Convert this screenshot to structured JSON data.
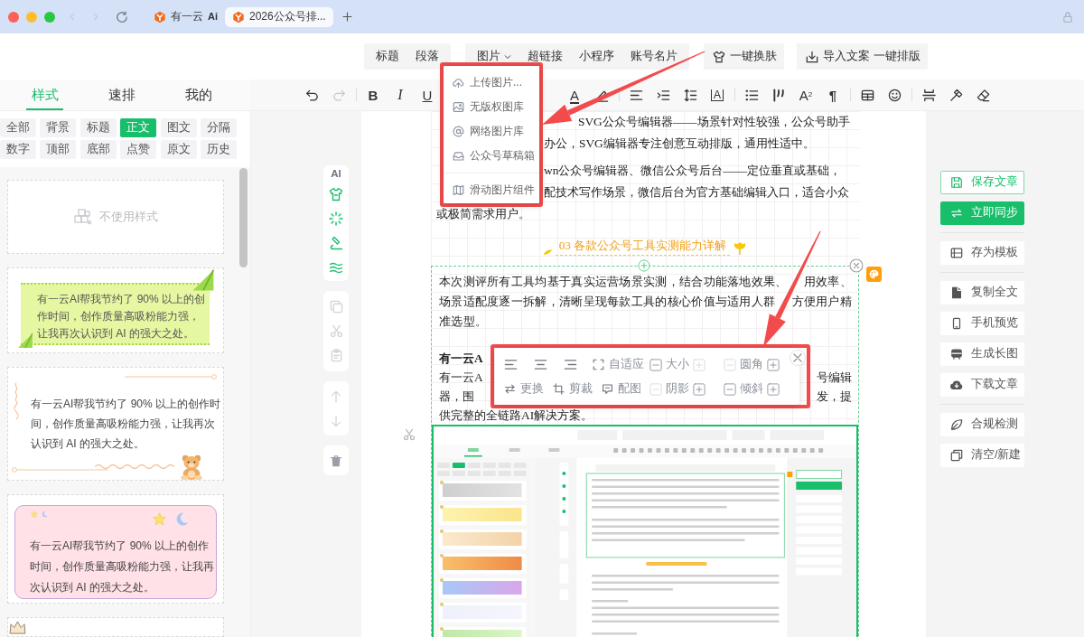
{
  "browser": {
    "tabs": [
      {
        "title": "有一云",
        "badge": "Ai",
        "selected": false
      },
      {
        "title": "2026公众号排...",
        "selected": true
      }
    ]
  },
  "insert_bar": {
    "groups": [
      [
        {
          "kind": "link",
          "label": "标题"
        },
        {
          "kind": "link",
          "label": "段落"
        }
      ],
      [
        {
          "kind": "menu",
          "label": "图片",
          "expanded": true
        },
        {
          "kind": "link",
          "label": "超链接"
        },
        {
          "kind": "link",
          "label": "小程序"
        },
        {
          "kind": "link",
          "label": "账号名片"
        }
      ]
    ],
    "actions": [
      {
        "label": "一键换肤"
      },
      {
        "label": "导入文案 一键排版"
      }
    ]
  },
  "image_menu": {
    "sections": [
      [
        {
          "label": "上传图片..."
        },
        {
          "label": "无版权图库"
        },
        {
          "label": "网络图片库"
        },
        {
          "label": "公众号草稿箱"
        }
      ],
      [
        {
          "label": "滑动图片组件"
        }
      ]
    ]
  },
  "panel_tabs": [
    {
      "label": "样式",
      "selected": true
    },
    {
      "label": "速排",
      "selected": false
    },
    {
      "label": "我的",
      "selected": false
    }
  ],
  "categories": [
    {
      "label": "全部",
      "selected": false
    },
    {
      "label": "背景",
      "selected": false
    },
    {
      "label": "标题",
      "selected": false
    },
    {
      "label": "正文",
      "selected": true
    },
    {
      "label": "图文",
      "selected": false
    },
    {
      "label": "分隔",
      "selected": false
    },
    {
      "label": "数字",
      "selected": false
    },
    {
      "label": "顶部",
      "selected": false
    },
    {
      "label": "底部",
      "selected": false
    },
    {
      "label": "点赞",
      "selected": false
    },
    {
      "label": "原文",
      "selected": false
    },
    {
      "label": "历史",
      "selected": false
    }
  ],
  "style_cards": [
    {
      "kind": "none",
      "label": "不使用样式"
    },
    {
      "kind": "green-note",
      "text": "有一云AI帮我节约了 90% 以上的创作时间，创作质量高吸粉能力强，让我再次认识到 AI 的强大之处。"
    },
    {
      "kind": "bear-note",
      "text": "有一云AI帮我节约了 90% 以上的创作时间，创作质量高吸粉能力强，让我再次认识到 AI 的强大之处。"
    },
    {
      "kind": "night-note",
      "text": "有一云AI帮我节约了 90% 以上的创作时间，创作质量高吸粉能力强，让我再次认识到 AI 的强大之处。"
    },
    {
      "kind": "cut-off"
    }
  ],
  "format_toolbar": {
    "left": [
      {
        "kind": "undo",
        "disabled": false
      },
      {
        "kind": "redo",
        "disabled": true
      },
      {
        "kind": "separator"
      },
      {
        "kind": "bold",
        "glyph": "B",
        "disabled": false
      },
      {
        "kind": "italic",
        "glyph": "I",
        "disabled": false
      },
      {
        "kind": "underline",
        "glyph": "U",
        "disabled": false
      }
    ],
    "right": [
      {
        "kind": "font-color",
        "glyph": "A",
        "disabled": false
      },
      {
        "kind": "highlight",
        "disabled": false
      },
      {
        "kind": "separator"
      },
      {
        "kind": "align",
        "disabled": false
      },
      {
        "kind": "indent",
        "disabled": false
      },
      {
        "kind": "line-height",
        "disabled": false
      },
      {
        "kind": "letter-spacing",
        "glyph": "A",
        "disabled": false
      },
      {
        "kind": "separator"
      },
      {
        "kind": "list",
        "disabled": false
      },
      {
        "kind": "quote",
        "disabled": false
      },
      {
        "kind": "superscript",
        "glyph": "A$^{2}$",
        "disabled": false
      },
      {
        "kind": "paragraph",
        "glyph": "¶",
        "disabled": false
      },
      {
        "kind": "separator"
      },
      {
        "kind": "table",
        "disabled": false
      },
      {
        "kind": "emoji",
        "disabled": false
      },
      {
        "kind": "separator"
      },
      {
        "kind": "rule",
        "disabled": false
      },
      {
        "kind": "painter",
        "disabled": false
      },
      {
        "kind": "eraser",
        "disabled": false
      }
    ]
  },
  "block_tools": {
    "label": "AI",
    "clipboard_disabled": true
  },
  "article": {
    "covered_paragraphs": [
      {
        "lines": [
          "SVG公众号编辑器——场景针对性较强，公众号助手",
          "办公，SVG编辑器专注创意互动排版，通用性适中。"
        ]
      },
      {
        "lines": [
          "wn公众号编辑器、微信公众号后台——定位垂直或基础，",
          "配技术写作场景，微信后台为官方基础编辑入口，适合小众"
        ],
        "last_line": "或极简需求用户。"
      }
    ],
    "section_heading": "03 各款公众号工具实测能力详解",
    "selected_block": {
      "paragraph_lines": [
        {
          "left": "本次测评所有工具均基于真实运营场景实测，结合功能落地效果、",
          "right": "用效率、"
        },
        {
          "left": "场景适配度逐一拆解，清晰呈现每款工具的核心价值与适用人群",
          "right": "方便用户精"
        },
        {
          "left": "准选型。"
        }
      ],
      "covered_lines": [
        {
          "left": "有一云A",
          "bold": true
        },
        {
          "left": "有一云A",
          "right": "号编辑",
          "bold": false
        },
        {
          "left": "器，围",
          "right": "发，提",
          "bold": false
        }
      ],
      "last_line": "供完整的全链路AI解决方案。"
    }
  },
  "image_toolbar": {
    "rows": [
      {
        "tools": [
          {
            "kind": "align-left"
          },
          {
            "kind": "align-center"
          },
          {
            "kind": "align-right"
          }
        ],
        "action": {
          "kind": "fit",
          "label": "自适应"
        },
        "steppers": [
          {
            "label": "大小",
            "minus_disabled": false,
            "plus_disabled": true
          },
          {
            "label": "圆角",
            "minus_disabled": true,
            "plus_disabled": false
          }
        ]
      },
      {
        "tools": [
          {
            "kind": "swap",
            "label": "更换"
          },
          {
            "kind": "crop",
            "label": "剪裁"
          }
        ],
        "action": {
          "kind": "caption",
          "label": "配图"
        },
        "steppers": [
          {
            "label": "阴影",
            "minus_disabled": true,
            "plus_disabled": false
          },
          {
            "label": "倾斜",
            "minus_disabled": false,
            "plus_disabled": false
          }
        ]
      }
    ]
  },
  "side_actions": {
    "groups": [
      [
        {
          "kind": "outline",
          "label": "保存文章"
        },
        {
          "kind": "primary",
          "label": "立即同步"
        }
      ],
      [
        {
          "kind": "plain",
          "label": "存为模板"
        }
      ],
      [
        {
          "kind": "plain",
          "label": "复制全文"
        },
        {
          "kind": "plain",
          "label": "手机预览"
        },
        {
          "kind": "plain",
          "label": "生成长图"
        },
        {
          "kind": "plain",
          "label": "下载文章"
        }
      ],
      [
        {
          "kind": "plain",
          "label": "合规检测"
        },
        {
          "kind": "plain",
          "label": "清空/新建"
        }
      ]
    ]
  }
}
